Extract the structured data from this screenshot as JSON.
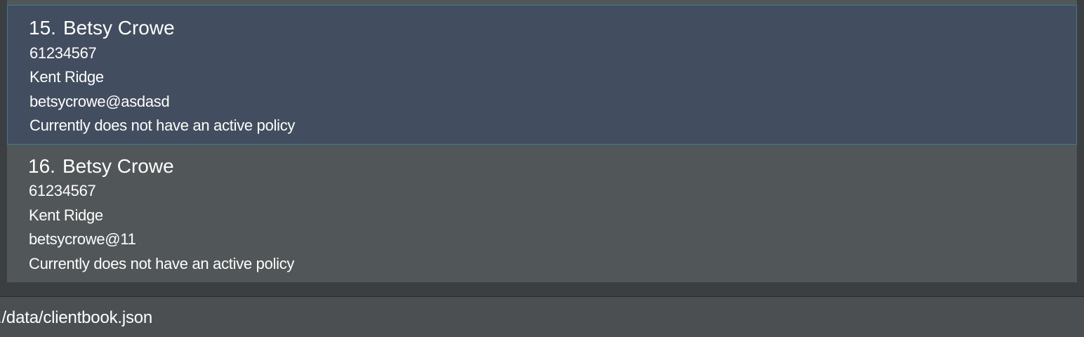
{
  "persons": [
    {
      "index": "15.",
      "name": "Betsy Crowe",
      "phone": "61234567",
      "address": "Kent Ridge",
      "email": "betsycrowe@asdasd",
      "policy": "Currently does not have an active policy",
      "selected": true
    },
    {
      "index": "16.",
      "name": "Betsy Crowe",
      "phone": "61234567",
      "address": "Kent Ridge",
      "email": "betsycrowe@11",
      "policy": "Currently does not have an active policy",
      "selected": false
    }
  ],
  "status_bar": {
    "file_path": "./data/clientbook.json"
  },
  "colors": {
    "background": "#3c3f41",
    "card": "#515658",
    "selected_card": "#424d5f",
    "selected_border": "#3e7b91",
    "text": "#ffffff"
  }
}
